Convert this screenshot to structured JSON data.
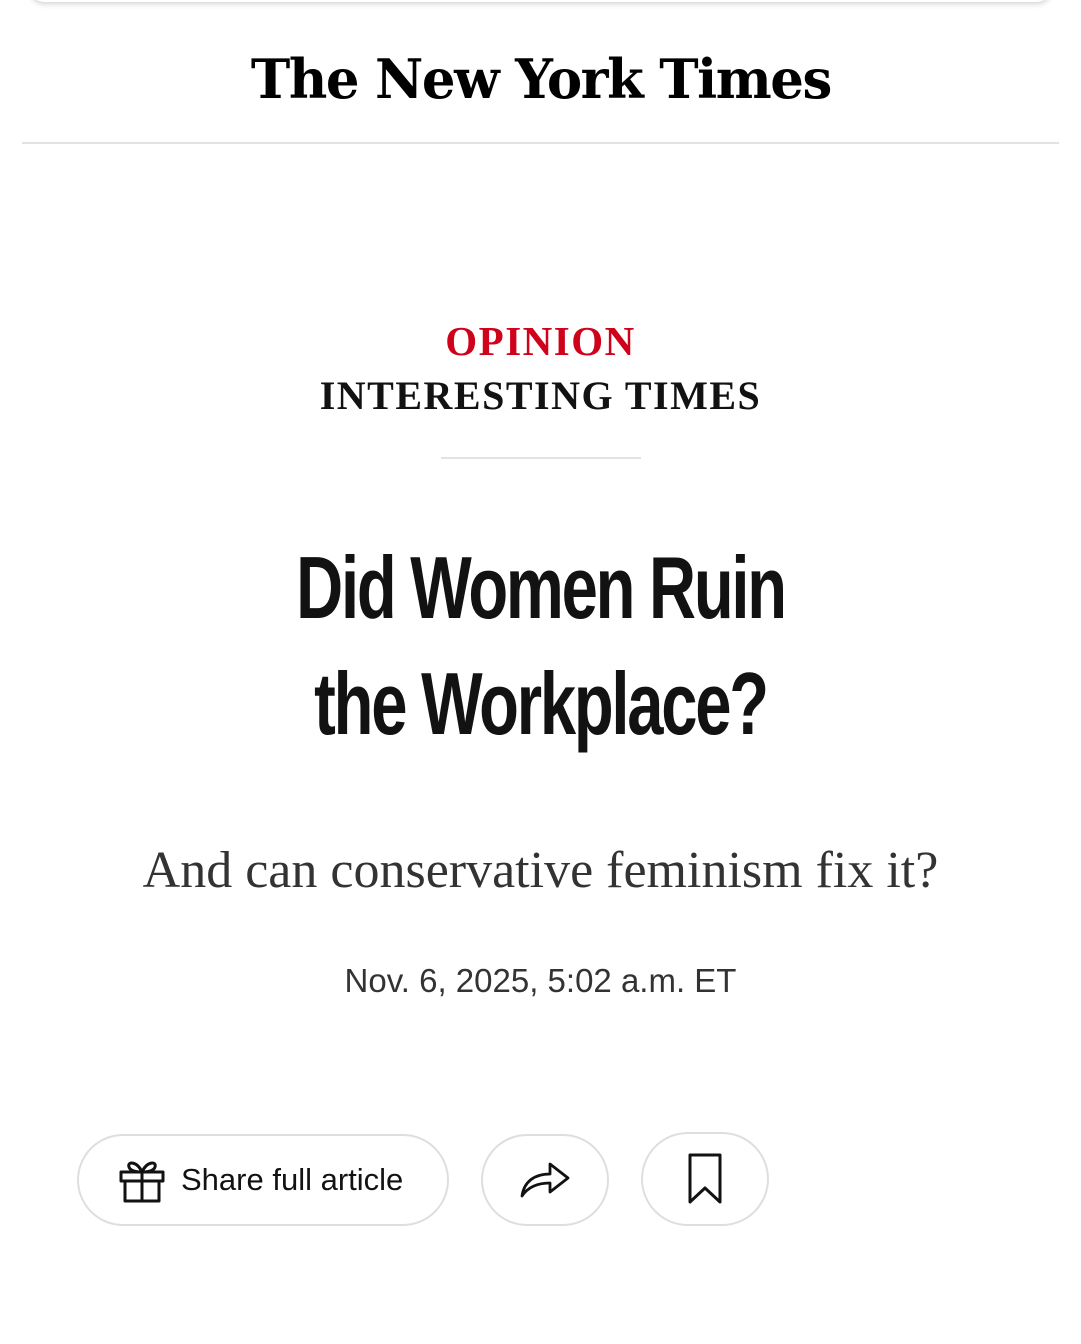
{
  "masthead": {
    "logo_text": "The New York Times"
  },
  "article": {
    "section_label": "OPINION",
    "column_label": "INTERESTING TIMES",
    "headline_line1": "Did Women Ruin",
    "headline_line2": "the Workplace?",
    "summary": "And can conservative feminism fix it?",
    "timestamp": "Nov. 6, 2025, 5:02 a.m. ET"
  },
  "actions": {
    "share_full_label": "Share full article",
    "share_icon": "share-arrow-icon",
    "gift_icon": "gift-icon",
    "save_icon": "bookmark-icon"
  },
  "colors": {
    "section_red": "#d0021b",
    "text_dark": "#121212",
    "text_muted": "#333333",
    "rule": "#e2e2e2"
  }
}
